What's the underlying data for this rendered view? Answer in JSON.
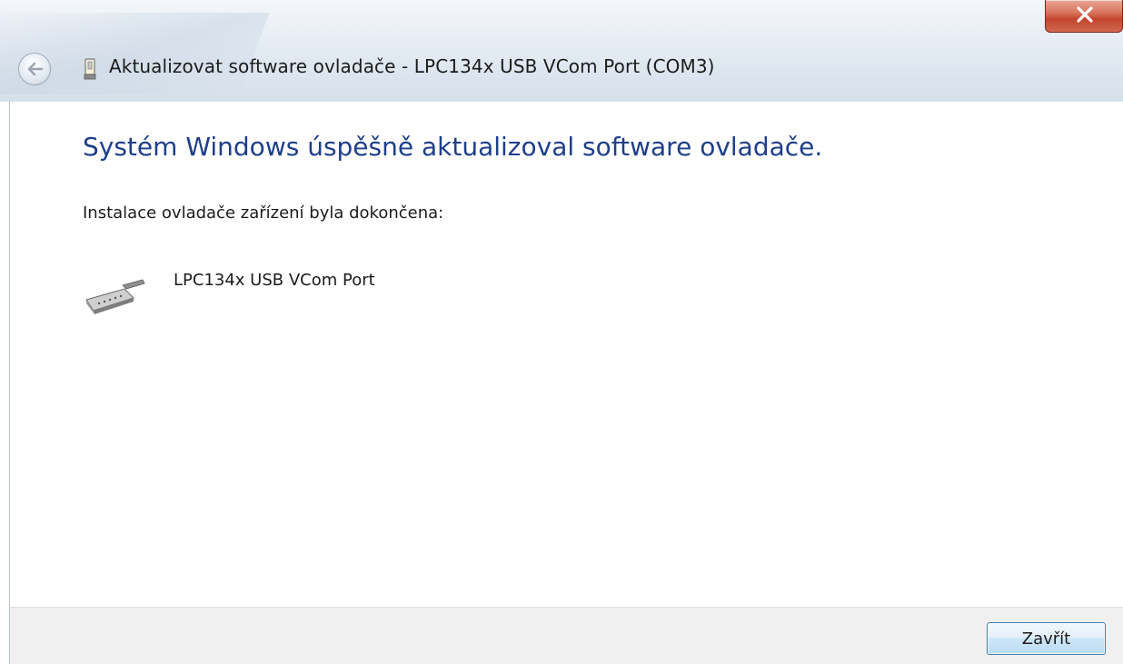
{
  "window": {
    "title": "Aktualizovat software ovladače - LPC134x USB VCom Port (COM3)"
  },
  "content": {
    "heading": "Systém Windows úspěšně aktualizoval software ovladače.",
    "subtitle": "Instalace ovladače zařízení byla dokončena:",
    "device": {
      "name": "LPC134x USB VCom Port",
      "icon": "serial-port-icon"
    }
  },
  "footer": {
    "close_label": "Zavřít"
  },
  "colors": {
    "heading": "#1e3f8a",
    "close_button_red": "#c2452c",
    "footer_bg": "#f0f0f0"
  },
  "icons": {
    "back": "back-arrow-icon",
    "title": "usb-device-icon",
    "close": "close-icon"
  }
}
